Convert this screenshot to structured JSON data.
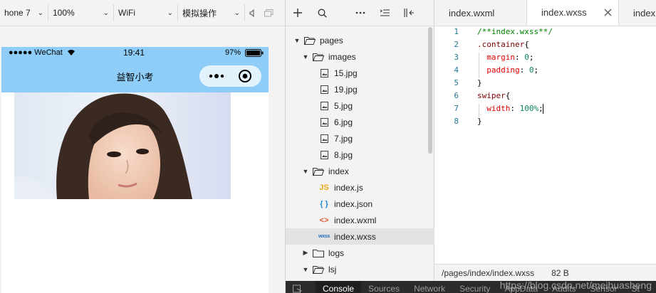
{
  "simulator": {
    "device": "hone 7",
    "zoom": "100%",
    "network": "WiFi",
    "operation": "模拟操作",
    "status": {
      "carrier": "●●●●● WeChat",
      "time": "19:41",
      "battery": "97%"
    },
    "title": "益智小考"
  },
  "tree": {
    "items": [
      {
        "label": "pages",
        "type": "folder",
        "open": true
      },
      {
        "label": "images",
        "type": "folder",
        "open": true
      },
      {
        "label": "15.jpg",
        "type": "image"
      },
      {
        "label": "19.jpg",
        "type": "image"
      },
      {
        "label": "5.jpg",
        "type": "image"
      },
      {
        "label": "6.jpg",
        "type": "image"
      },
      {
        "label": "7.jpg",
        "type": "image"
      },
      {
        "label": "8.jpg",
        "type": "image"
      },
      {
        "label": "index",
        "type": "folder",
        "open": true
      },
      {
        "label": "index.js",
        "type": "js"
      },
      {
        "label": "index.json",
        "type": "json"
      },
      {
        "label": "index.wxml",
        "type": "wxml"
      },
      {
        "label": "index.wxss",
        "type": "wxss",
        "selected": true
      },
      {
        "label": "logs",
        "type": "folder",
        "open": false
      },
      {
        "label": "lsj",
        "type": "folder",
        "open": true
      }
    ]
  },
  "editor": {
    "tabs": [
      {
        "label": "index.wxml"
      },
      {
        "label": "index.wxss",
        "active": true
      },
      {
        "label": "index"
      }
    ],
    "lines": [
      {
        "n": "1",
        "segs": [
          {
            "t": "/**index.wxss**/",
            "c": "cmt"
          }
        ]
      },
      {
        "n": "2",
        "segs": [
          {
            "t": ".container",
            "c": "sel-c"
          },
          {
            "t": "{",
            "c": "pun"
          }
        ]
      },
      {
        "n": "3",
        "segs": [
          {
            "t": "  margin",
            "c": "prop"
          },
          {
            "t": ": ",
            "c": "pun"
          },
          {
            "t": "0",
            "c": "num"
          },
          {
            "t": ";",
            "c": "pun"
          }
        ]
      },
      {
        "n": "4",
        "segs": [
          {
            "t": "  padding",
            "c": "prop"
          },
          {
            "t": ": ",
            "c": "pun"
          },
          {
            "t": "0",
            "c": "num"
          },
          {
            "t": ";",
            "c": "pun"
          }
        ]
      },
      {
        "n": "5",
        "segs": [
          {
            "t": "}",
            "c": "pun"
          }
        ]
      },
      {
        "n": "6",
        "segs": [
          {
            "t": "swiper",
            "c": "sel-c"
          },
          {
            "t": "{",
            "c": "pun"
          }
        ]
      },
      {
        "n": "7",
        "segs": [
          {
            "t": "  width",
            "c": "prop"
          },
          {
            "t": ": ",
            "c": "pun"
          },
          {
            "t": "100%",
            "c": "num"
          },
          {
            "t": ";",
            "c": "pun"
          }
        ]
      },
      {
        "n": "8",
        "segs": [
          {
            "t": "}",
            "c": "pun"
          }
        ]
      }
    ],
    "status": {
      "path": "/pages/index/index.wxss",
      "size": "82 B"
    }
  },
  "devtools": {
    "tabs": [
      "Console",
      "Sources",
      "Network",
      "Security",
      "AppData",
      "Audits",
      "Sensor",
      "St"
    ],
    "active": "Console"
  },
  "watermark": "https://blog.csdn.net/meihuasheng"
}
